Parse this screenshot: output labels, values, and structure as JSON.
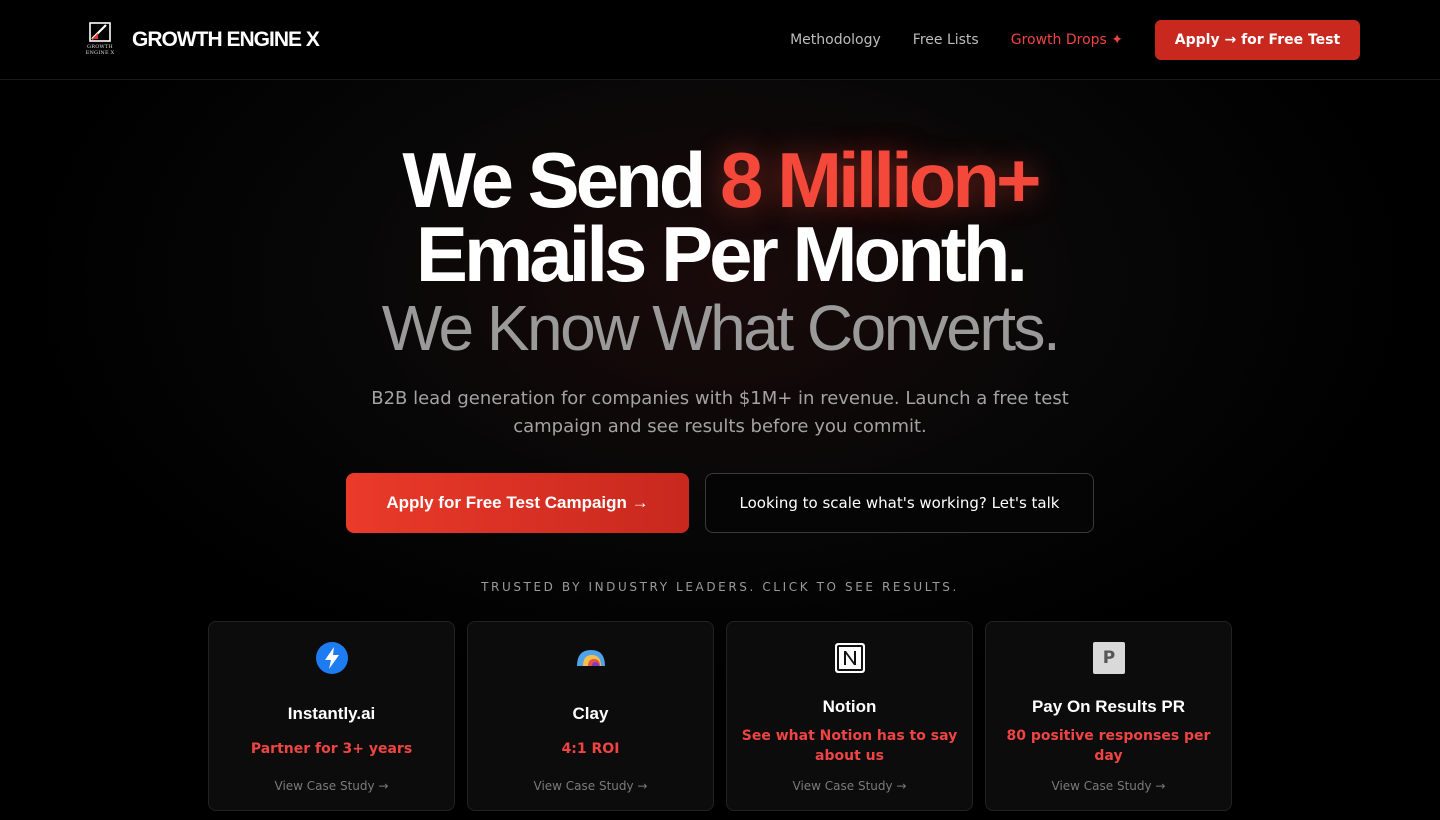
{
  "header": {
    "brand": "GROWTH ENGINE X",
    "logo_subtext": [
      "GROWTH",
      "ENGINE X"
    ],
    "nav": [
      {
        "label": "Methodology"
      },
      {
        "label": "Free Lists"
      },
      {
        "label": "Growth Drops ✦"
      }
    ],
    "cta_label": "Apply → for Free Test"
  },
  "hero": {
    "line1_prefix": "We Send ",
    "line1_highlight": "8 Million+",
    "line2": "Emails Per Month.",
    "line3": "We Know What Converts.",
    "lead": "B2B lead generation for companies with $1M+ in revenue. Launch a free test campaign and see results before you commit.",
    "primary_cta": "Apply for Free Test Campaign →",
    "secondary_cta": "Looking to scale what's working? Let's talk"
  },
  "trusted": {
    "label": "TRUSTED BY INDUSTRY LEADERS. CLICK TO SEE RESULTS.",
    "cards": [
      {
        "name": "Instantly.ai",
        "metric": "Partner for 3+ years",
        "link": "View Case Study →",
        "icon": "lightning-icon"
      },
      {
        "name": "Clay",
        "metric": "4:1 ROI",
        "link": "View Case Study →",
        "icon": "clay-logo-icon"
      },
      {
        "name": "Notion",
        "metric": "See what Notion has to say about us",
        "link": "View Case Study →",
        "icon": "notion-logo-icon"
      },
      {
        "name": "Pay On Results PR",
        "metric": "80 positive responses per day",
        "link": "View Case Study →",
        "icon": "p-letter-icon",
        "icon_letter": "P"
      }
    ]
  },
  "colors": {
    "accent": "#ef4444",
    "cta": "#c8281e",
    "background": "#000000"
  }
}
